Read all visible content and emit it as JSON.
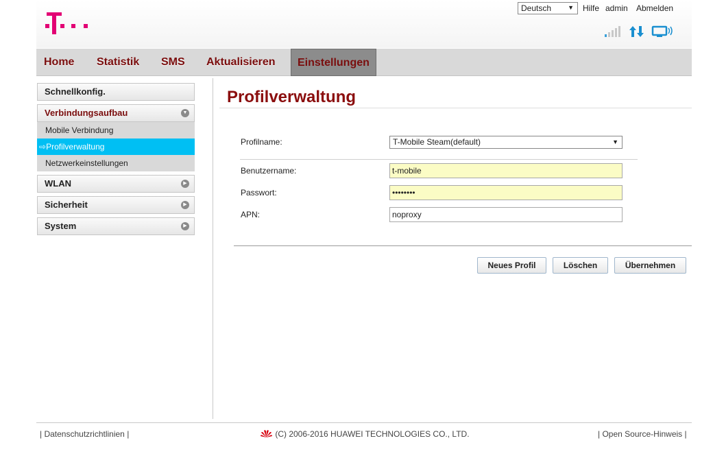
{
  "header": {
    "language": "Deutsch",
    "links": {
      "help": "Hilfe",
      "user": "admin",
      "logout": "Abmelden"
    },
    "brand_color": "#e20074"
  },
  "nav": {
    "items": [
      {
        "label": "Home"
      },
      {
        "label": "Statistik"
      },
      {
        "label": "SMS"
      },
      {
        "label": "Aktualisieren"
      },
      {
        "label": "Einstellungen",
        "active": true
      }
    ]
  },
  "sidebar": {
    "quick": "Schnellkonfig.",
    "connection": {
      "label": "Verbindungsaufbau",
      "sub": [
        {
          "label": "Mobile Verbindung"
        },
        {
          "label": "Profilverwaltung",
          "active": true,
          "prefix": "⇨"
        },
        {
          "label": "Netzwerkeinstellungen"
        }
      ]
    },
    "wlan": "WLAN",
    "security": "Sicherheit",
    "system": "System"
  },
  "main": {
    "title": "Profilverwaltung",
    "profile_label": "Profilname:",
    "profile_value": "T-Mobile Steam(default)",
    "username_label": "Benutzername:",
    "username_value": "t-mobile",
    "password_label": "Passwort:",
    "password_value": "••••••••",
    "apn_label": "APN:",
    "apn_value": "noproxy",
    "buttons": {
      "new": "Neues Profil",
      "delete": "Löschen",
      "apply": "Übernehmen"
    },
    "title_color": "#8b0e0e",
    "active_color": "#00bff3"
  },
  "footer": {
    "privacy": "Datenschutzrichtlinien",
    "copyright": "(C) 2006-2016 HUAWEI TECHNOLOGIES CO., LTD.",
    "open_source": "Open Source-Hinweis"
  }
}
